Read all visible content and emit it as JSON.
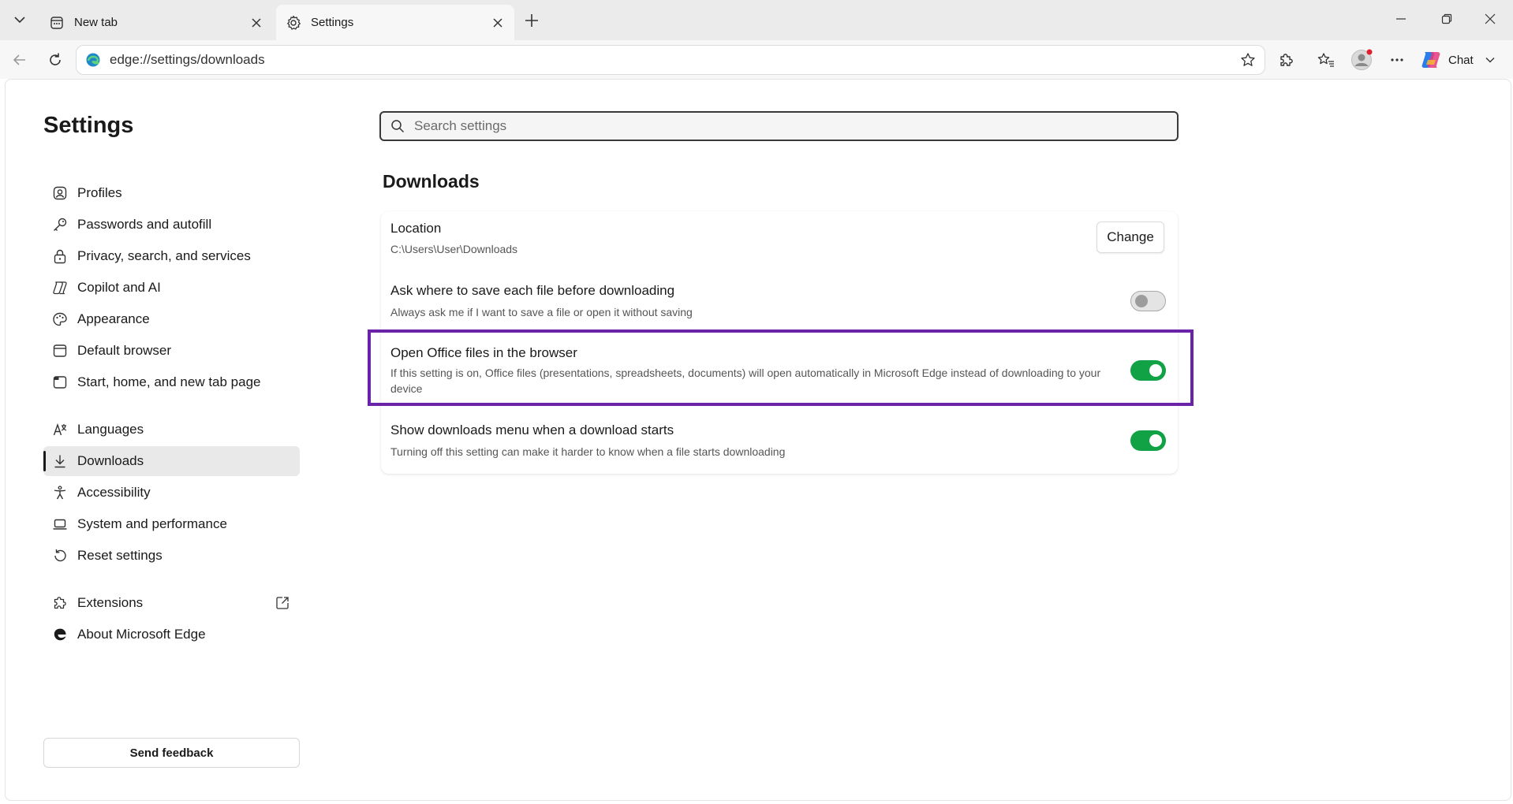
{
  "browser": {
    "tabs": [
      {
        "label": "New tab"
      },
      {
        "label": "Settings"
      }
    ],
    "address_url": "edge://settings/downloads",
    "chat_label": "Chat"
  },
  "sidebar": {
    "title": "Settings",
    "items": [
      {
        "label": "Profiles",
        "icon": "profile-icon"
      },
      {
        "label": "Passwords and autofill",
        "icon": "key-icon"
      },
      {
        "label": "Privacy, search, and services",
        "icon": "lock-icon"
      },
      {
        "label": "Copilot and AI",
        "icon": "copilot-icon"
      },
      {
        "label": "Appearance",
        "icon": "palette-icon"
      },
      {
        "label": "Default browser",
        "icon": "browser-icon"
      },
      {
        "label": "Start, home, and new tab page",
        "icon": "home-icon"
      },
      {
        "label": "Languages",
        "icon": "languages-icon"
      },
      {
        "label": "Downloads",
        "icon": "download-icon",
        "active": true
      },
      {
        "label": "Accessibility",
        "icon": "accessibility-icon"
      },
      {
        "label": "System and performance",
        "icon": "laptop-icon"
      },
      {
        "label": "Reset settings",
        "icon": "reset-icon"
      },
      {
        "label": "Extensions",
        "icon": "puzzle-icon"
      },
      {
        "label": "About Microsoft Edge",
        "icon": "edge-icon"
      }
    ],
    "feedback_label": "Send feedback"
  },
  "main": {
    "search_placeholder": "Search settings",
    "section_title": "Downloads",
    "settings": [
      {
        "title": "Location",
        "desc": "C:\\Users\\User\\Downloads",
        "button": "Change"
      },
      {
        "title": "Ask where to save each file before downloading",
        "desc": "Always ask me if I want to save a file or open it without saving",
        "enabled": false
      },
      {
        "title": "Open Office files in the browser",
        "desc": "If this setting is on, Office files (presentations, spreadsheets, documents) will open automatically in Microsoft Edge instead of downloading to your device",
        "enabled": true,
        "highlighted": true
      },
      {
        "title": "Show downloads menu when a download starts",
        "desc": "Turning off this setting can make it harder to know when a file starts downloading",
        "enabled": true
      }
    ]
  },
  "colors": {
    "toggle_on": "#10a245",
    "highlight_border": "#6a22a8",
    "titlebar_bg": "#ebebeb"
  }
}
